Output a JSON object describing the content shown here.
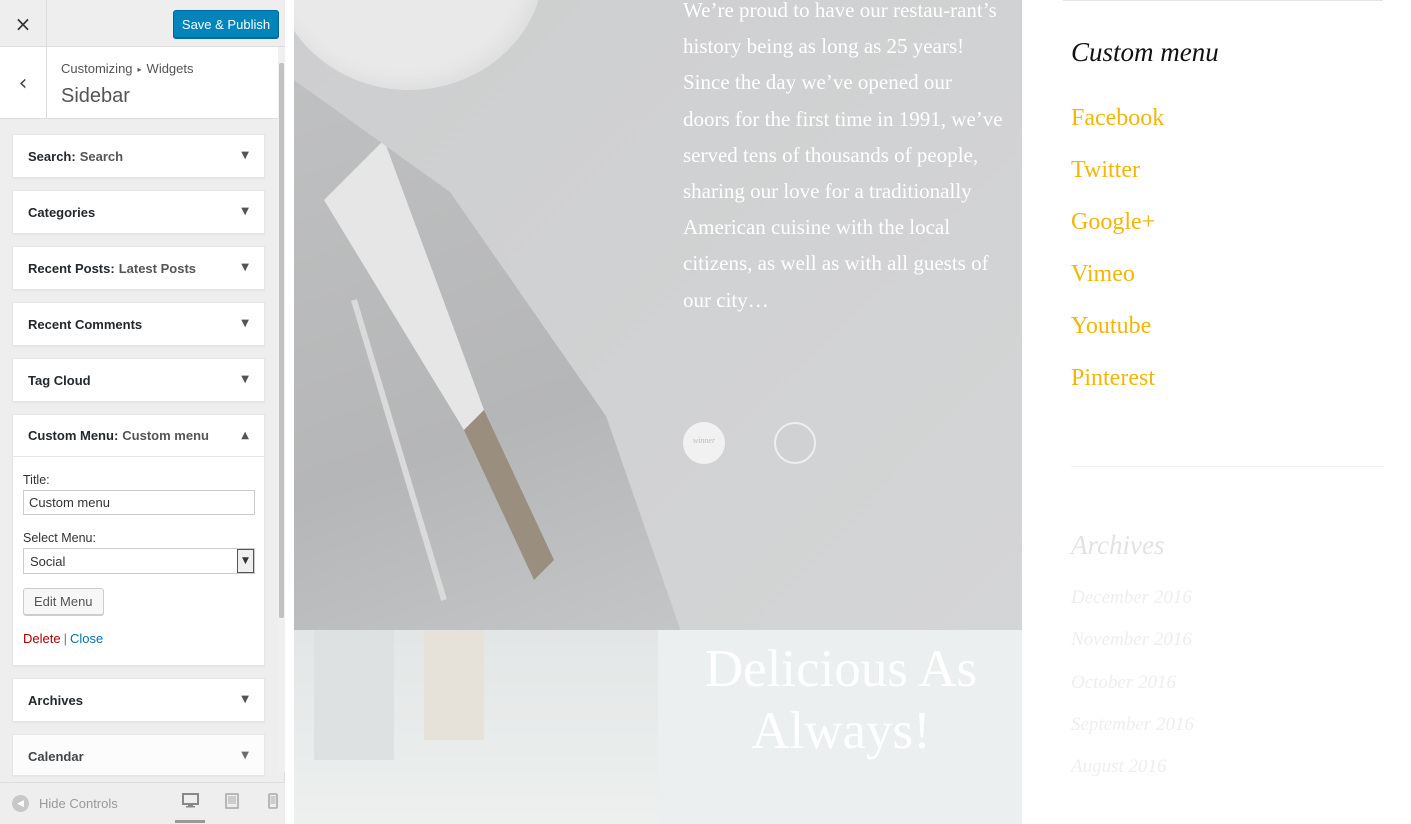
{
  "customizer": {
    "close_icon": "×",
    "save_label": "Save & Publish",
    "back_icon": "‹",
    "breadcrumb": {
      "root": "Customizing",
      "separator": "▸",
      "current": "Widgets"
    },
    "section_title": "Sidebar",
    "widgets": [
      {
        "name": "Search:",
        "subtitle": "Search"
      },
      {
        "name": "Categories",
        "subtitle": ""
      },
      {
        "name": "Recent Posts:",
        "subtitle": "Latest Posts"
      },
      {
        "name": "Recent Comments",
        "subtitle": ""
      },
      {
        "name": "Tag Cloud",
        "subtitle": ""
      },
      {
        "name": "Custom Menu:",
        "subtitle": "Custom menu"
      },
      {
        "name": "Archives",
        "subtitle": ""
      },
      {
        "name": "Calendar",
        "subtitle": ""
      }
    ],
    "open_widget": {
      "title_label": "Title:",
      "title_value": "Custom menu",
      "menu_label": "Select Menu:",
      "menu_selected": "Social",
      "edit_button": "Edit Menu",
      "delete_link": "Delete",
      "separator": "|",
      "close_link": "Close"
    },
    "arrow_down": "▼",
    "arrow_up": "▲",
    "footer": {
      "hide_controls": "Hide Controls",
      "hide_icon": "◀"
    }
  },
  "preview": {
    "story_text": "We’re proud to have our restau-rant’s history being as long as 25 years! Since the day we’ve opened our doors for the first time in 1991, we’ve served tens of thousands of people, sharing our love for a traditionally American cuisine with the local citizens, as well as with all guests of our city…",
    "badge1": "winner",
    "badge2": "",
    "headline": "Delicious As Always!",
    "sidebar": {
      "widget_title": "Custom menu",
      "links": [
        "Facebook",
        "Twitter",
        "Google+",
        "Vimeo",
        "Youtube",
        "Pinterest"
      ],
      "archives_title": "Archives",
      "archives": [
        "December 2016",
        "November 2016",
        "October 2016",
        "September 2016",
        "August 2016"
      ]
    }
  },
  "colors": {
    "primary_button": "#0085ba",
    "link_accent": "#f2b705",
    "delete": "#a00",
    "close": "#0073aa"
  }
}
